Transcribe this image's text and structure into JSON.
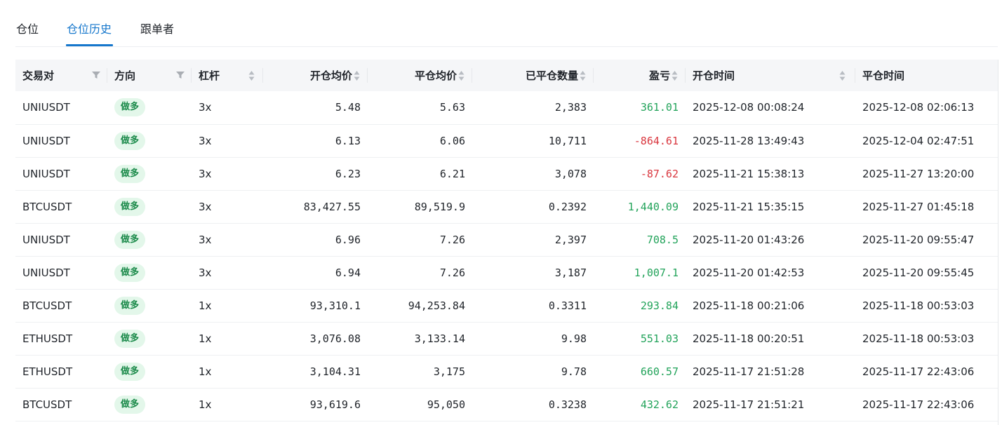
{
  "tabs": [
    {
      "label": "仓位",
      "active": false
    },
    {
      "label": "仓位历史",
      "active": true
    },
    {
      "label": "跟单者",
      "active": false
    }
  ],
  "table": {
    "headers": {
      "pair": "交易对",
      "side": "方向",
      "leverage": "杠杆",
      "open_price": "开仓均价",
      "close_price": "平仓均价",
      "closed_qty": "已平仓数量",
      "pnl": "盈亏",
      "open_time": "开仓时间",
      "close_time": "平仓时间"
    },
    "rows": [
      {
        "pair": "UNIUSDT",
        "side": "做多",
        "leverage": "3x",
        "open_price": "5.48",
        "close_price": "5.63",
        "closed_qty": "2,383",
        "pnl": "361.01",
        "pnl_sign": "pos",
        "open_time": "2025-12-08 00:08:24",
        "close_time": "2025-12-08 02:06:13"
      },
      {
        "pair": "UNIUSDT",
        "side": "做多",
        "leverage": "3x",
        "open_price": "6.13",
        "close_price": "6.06",
        "closed_qty": "10,711",
        "pnl": "-864.61",
        "pnl_sign": "neg",
        "open_time": "2025-11-28 13:49:43",
        "close_time": "2025-12-04 02:47:51"
      },
      {
        "pair": "UNIUSDT",
        "side": "做多",
        "leverage": "3x",
        "open_price": "6.23",
        "close_price": "6.21",
        "closed_qty": "3,078",
        "pnl": "-87.62",
        "pnl_sign": "neg",
        "open_time": "2025-11-21 15:38:13",
        "close_time": "2025-11-27 13:20:00"
      },
      {
        "pair": "BTCUSDT",
        "side": "做多",
        "leverage": "3x",
        "open_price": "83,427.55",
        "close_price": "89,519.9",
        "closed_qty": "0.2392",
        "pnl": "1,440.09",
        "pnl_sign": "pos",
        "open_time": "2025-11-21 15:35:15",
        "close_time": "2025-11-27 01:45:18"
      },
      {
        "pair": "UNIUSDT",
        "side": "做多",
        "leverage": "3x",
        "open_price": "6.96",
        "close_price": "7.26",
        "closed_qty": "2,397",
        "pnl": "708.5",
        "pnl_sign": "pos",
        "open_time": "2025-11-20 01:43:26",
        "close_time": "2025-11-20 09:55:47"
      },
      {
        "pair": "UNIUSDT",
        "side": "做多",
        "leverage": "3x",
        "open_price": "6.94",
        "close_price": "7.26",
        "closed_qty": "3,187",
        "pnl": "1,007.1",
        "pnl_sign": "pos",
        "open_time": "2025-11-20 01:42:53",
        "close_time": "2025-11-20 09:55:45"
      },
      {
        "pair": "BTCUSDT",
        "side": "做多",
        "leverage": "1x",
        "open_price": "93,310.1",
        "close_price": "94,253.84",
        "closed_qty": "0.3311",
        "pnl": "293.84",
        "pnl_sign": "pos",
        "open_time": "2025-11-18 00:21:06",
        "close_time": "2025-11-18 00:53:03"
      },
      {
        "pair": "ETHUSDT",
        "side": "做多",
        "leverage": "1x",
        "open_price": "3,076.08",
        "close_price": "3,133.14",
        "closed_qty": "9.98",
        "pnl": "551.03",
        "pnl_sign": "pos",
        "open_time": "2025-11-18 00:20:51",
        "close_time": "2025-11-18 00:53:03"
      },
      {
        "pair": "ETHUSDT",
        "side": "做多",
        "leverage": "1x",
        "open_price": "3,104.31",
        "close_price": "3,175",
        "closed_qty": "9.78",
        "pnl": "660.57",
        "pnl_sign": "pos",
        "open_time": "2025-11-17 21:51:28",
        "close_time": "2025-11-17 22:43:06"
      },
      {
        "pair": "BTCUSDT",
        "side": "做多",
        "leverage": "1x",
        "open_price": "93,619.6",
        "close_price": "95,050",
        "closed_qty": "0.3238",
        "pnl": "432.62",
        "pnl_sign": "pos",
        "open_time": "2025-11-17 21:51:21",
        "close_time": "2025-11-17 22:43:06"
      }
    ]
  },
  "colors": {
    "accent": "#1677cc",
    "profit": "#22a35a",
    "loss": "#d9363e",
    "long_badge_bg": "#e3f7ea",
    "long_badge_text": "#1b8a4a",
    "header_bg": "#f5f6f8"
  },
  "icons": {
    "filter": "filter-icon",
    "sort": "sort-icon"
  }
}
